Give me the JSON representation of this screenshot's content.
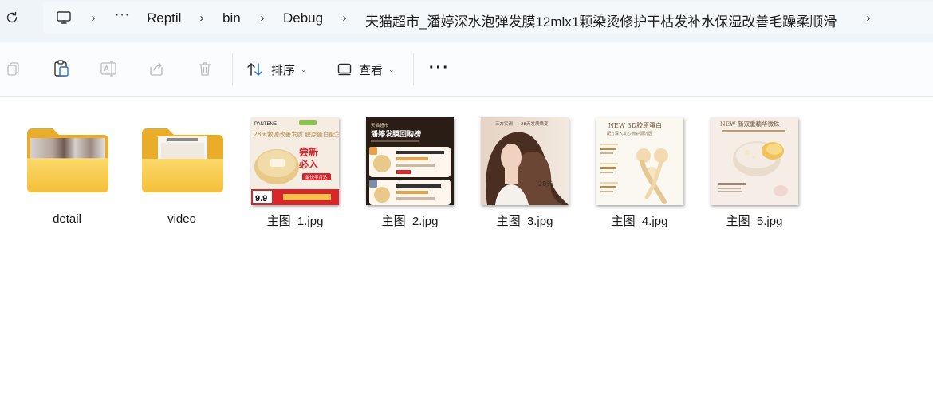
{
  "address_bar": {
    "breadcrumbs": [
      "Reptil",
      "bin",
      "Debug",
      "天猫超市_潘婷深水泡弹发膜12mlx1颗染烫修护干枯发补水保湿改善毛躁柔顺滑"
    ],
    "more_label": "···"
  },
  "toolbar": {
    "sort_label": "排序",
    "view_label": "查看",
    "more_label": "···"
  },
  "files": [
    {
      "name": "detail",
      "type": "folder"
    },
    {
      "name": "video",
      "type": "folder"
    },
    {
      "name": "主图_1.jpg",
      "type": "image"
    },
    {
      "name": "主图_2.jpg",
      "type": "image"
    },
    {
      "name": "主图_3.jpg",
      "type": "image"
    },
    {
      "name": "主图_4.jpg",
      "type": "image"
    },
    {
      "name": "主图_5.jpg",
      "type": "image"
    }
  ],
  "thumb_texts": {
    "img1": {
      "brand": "PANTENE",
      "headline": "28天救源改善发质 胶原蛋白配方",
      "badge1": "尝新",
      "badge2": "必入",
      "price": "9.9",
      "tag": "最快半月达"
    },
    "img2": {
      "title": "潘婷发膜回购榜",
      "store": "天猫超市"
    },
    "img3": {
      "tag1": "三方实测",
      "tag2": "28天发质焕变",
      "days": "28天"
    },
    "img4": {
      "title": "NEW 3D胶原蛋白",
      "sub": "配方深入发芯·修护源沉透"
    },
    "img5": {
      "title": "NEW 新双重精华微珠"
    }
  },
  "colors": {
    "folder_body": "#f5c54a",
    "folder_back": "#e9ad2a",
    "addr_bg": "#eff4f9",
    "accent_red": "#d8262b"
  }
}
